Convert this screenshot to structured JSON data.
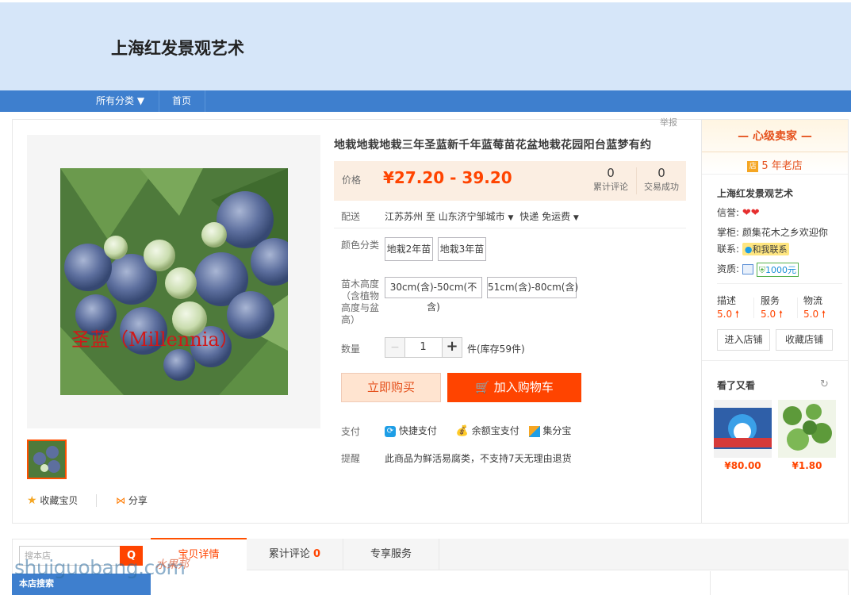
{
  "shop": {
    "name": "上海红发景观艺术"
  },
  "nav": {
    "all_categories": "所有分类 ▼",
    "home": "首页"
  },
  "report": "举报",
  "product": {
    "title": "地栽地栽地栽三年圣蓝新千年蓝莓苗花盆地栽花园阳台蓝梦有约",
    "image_caption": "圣蓝（Millennia）",
    "price_label": "价格",
    "price": "¥27.20 - 39.20",
    "reviews_count": "0",
    "reviews_label": "累计评论",
    "sales_count": "0",
    "sales_label": "交易成功",
    "delivery_label": "配送",
    "delivery_from": "江苏苏州 至",
    "delivery_to": "山东济宁邹城市",
    "delivery_method": "快递 免运费",
    "color_label": "颜色分类",
    "color_options": [
      "地栽2年苗",
      "地栽3年苗"
    ],
    "height_label": "苗木高度（含植物高度与盆高）",
    "height_options": [
      "30cm(含)-50cm(不含)",
      "51cm(含)-80cm(含)"
    ],
    "qty_label": "数量",
    "qty_value": "1",
    "qty_minus": "−",
    "qty_plus": "+",
    "stock_text": "件(库存59件)",
    "buy_now": "立即购买",
    "add_cart": "加入购物车",
    "pay_label": "支付",
    "pay_methods": [
      "快捷支付",
      "余额宝支付",
      "集分宝"
    ],
    "remind_label": "提醒",
    "remind_text": "此商品为鲜活易腐类，不支持7天无理由退货",
    "favorite": "收藏宝贝",
    "share": "分享"
  },
  "seller": {
    "level": "— 心级卖家 —",
    "years": "5 年老店",
    "name": "上海红发景观艺术",
    "credit_label": "信誉:",
    "keeper_label": "掌柜:",
    "keeper_name": "颜集花木之乡欢迎你",
    "contact_label": "联系:",
    "contact_btn": "和我联系",
    "qual_label": "资质:",
    "deposit": "1000元",
    "ratings": [
      {
        "label": "描述",
        "value": "5.0"
      },
      {
        "label": "服务",
        "value": "5.0"
      },
      {
        "label": "物流",
        "value": "5.0"
      }
    ],
    "enter_shop": "进入店铺",
    "fav_shop": "收藏店铺"
  },
  "also_viewed": {
    "title": "看了又看",
    "items": [
      {
        "price": "¥80.00"
      },
      {
        "price": "¥1.80"
      }
    ]
  },
  "bottom": {
    "search_placeholder": "搜本店",
    "shop_search": "本店搜索",
    "tabs": [
      {
        "label": "宝贝详情"
      },
      {
        "label": "累计评论",
        "count": "0"
      },
      {
        "label": "专享服务"
      }
    ]
  },
  "watermark": {
    "text": "shuiguobang.com",
    "cn": "水果邦"
  },
  "colors": {
    "accent": "#ff5000",
    "price": "#ff4400",
    "nav": "#3e7fce",
    "banner": "#d6e6f9"
  }
}
